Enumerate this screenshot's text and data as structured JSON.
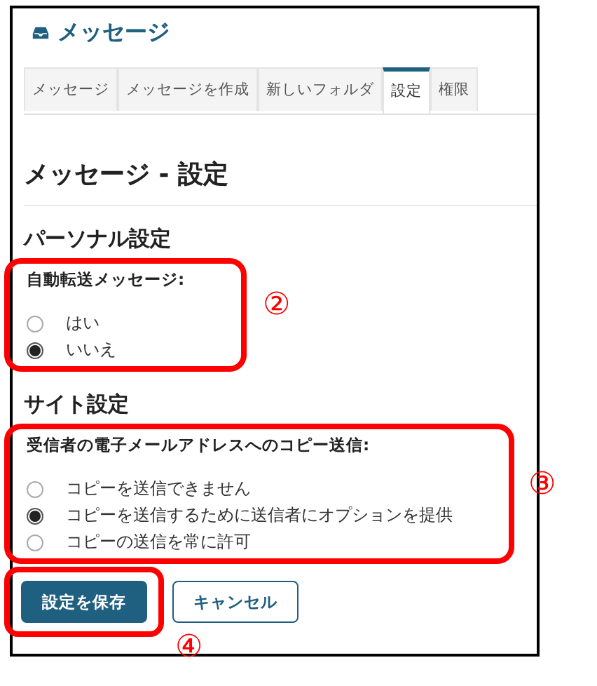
{
  "header": {
    "title": "メッセージ"
  },
  "tabs": [
    {
      "label": "メッセージ",
      "selected": false
    },
    {
      "label": "メッセージを作成",
      "selected": false
    },
    {
      "label": "新しいフォルダ",
      "selected": false
    },
    {
      "label": "設定",
      "selected": true
    },
    {
      "label": "権限",
      "selected": false
    }
  ],
  "page_title": "メッセージ - 設定",
  "sections": [
    {
      "heading": "パーソナル設定",
      "field": {
        "label": "自動転送メッセージ:",
        "callout": "②",
        "options": [
          {
            "label": "はい",
            "selected": false
          },
          {
            "label": "いいえ",
            "selected": true
          }
        ]
      }
    },
    {
      "heading": "サイト設定",
      "field": {
        "label": "受信者の電子メールアドレスへのコピー送信:",
        "callout": "③",
        "options": [
          {
            "label": "コピーを送信できません",
            "selected": false
          },
          {
            "label": "コピーを送信するために送信者にオプションを提供",
            "selected": true
          },
          {
            "label": "コピーの送信を常に許可",
            "selected": false
          }
        ]
      }
    }
  ],
  "buttons": [
    {
      "label": "設定を保存",
      "kind": "primary",
      "callout": "④"
    },
    {
      "label": "キャンセル",
      "kind": "secondary"
    }
  ]
}
